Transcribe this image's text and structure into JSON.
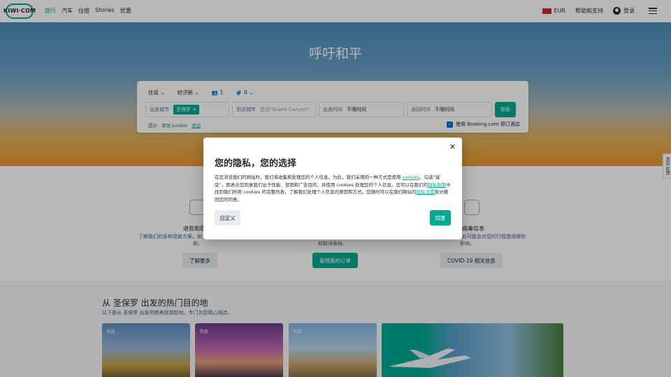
{
  "header": {
    "logo": "KIWI·COM",
    "nav": [
      "旅行",
      "汽车",
      "住宿",
      "Stories",
      "优惠"
    ],
    "currency": "EUR",
    "help": "帮助和支持",
    "login": "登录"
  },
  "hero": {
    "title": "呼吁和平"
  },
  "search": {
    "trip_type": "往返",
    "cabin": "经济舱",
    "passengers": "1",
    "bags": "0",
    "from_label": "出发城市",
    "from_chip": "圣保罗",
    "to_label": "到达城市",
    "to_placeholder": "尝试\"Grand Canyon\"",
    "depart_label": "出发时间",
    "depart_value": "不限时间",
    "return_label": "返回时间",
    "return_value": "不限时间",
    "explore": "探索",
    "tips_label": "提示",
    "tips_text": "添加 Jundiaí",
    "tips_link": "添加",
    "booking": "使用 Booking.com 预订酒店"
  },
  "info": {
    "col1_title": "退款和取",
    "col1_text1": "了解我们的多种退款方案，如",
    "col1_text2": "款。",
    "col1_btn": "了解更多",
    "col2_text": "和取消表格。",
    "col2_btn": "管理我的订单",
    "col3_title": "病毒信息",
    "col3_text1": "此可能会对您的行程造成哪些",
    "col3_text2": "影响。",
    "col3_btn": "COVID-19 相关信息",
    "side_tab": "意见 反馈"
  },
  "destinations": {
    "title": "从 圣保罗 出发的热门目的地",
    "subtitle": "以下是从 圣保罗 出发的绝美旅游胜地，专门为您精心挑选。",
    "tag1": "节庆",
    "tag2": "节庆",
    "tag3": "节庆"
  },
  "modal": {
    "title": "您的隐私，您的选择",
    "text_1": "在您浏览我们的网站时，我们将收集和处理您的个人信息。为此，我们采用的一种方式是使用 ",
    "link_cookies": "cookies",
    "text_2": "。勾选“接受”，即表示您同意我们出于性能、营销和广告目的，并使用 cookies 处理您的个人信息。您可以在我们的",
    "link_policy": "隐私政策",
    "text_3": "中找到我们所用 cookies 的完整列表，了解我们处理个人信息的原因和方式。您随时可以在我们网站的",
    "link_settings": "隐私设置",
    "text_4": "部分撤回您的同意。",
    "customize": "自定义",
    "agree": "同意"
  },
  "colors": {
    "accent": "#00a991",
    "checkbox": "#0172cb"
  }
}
